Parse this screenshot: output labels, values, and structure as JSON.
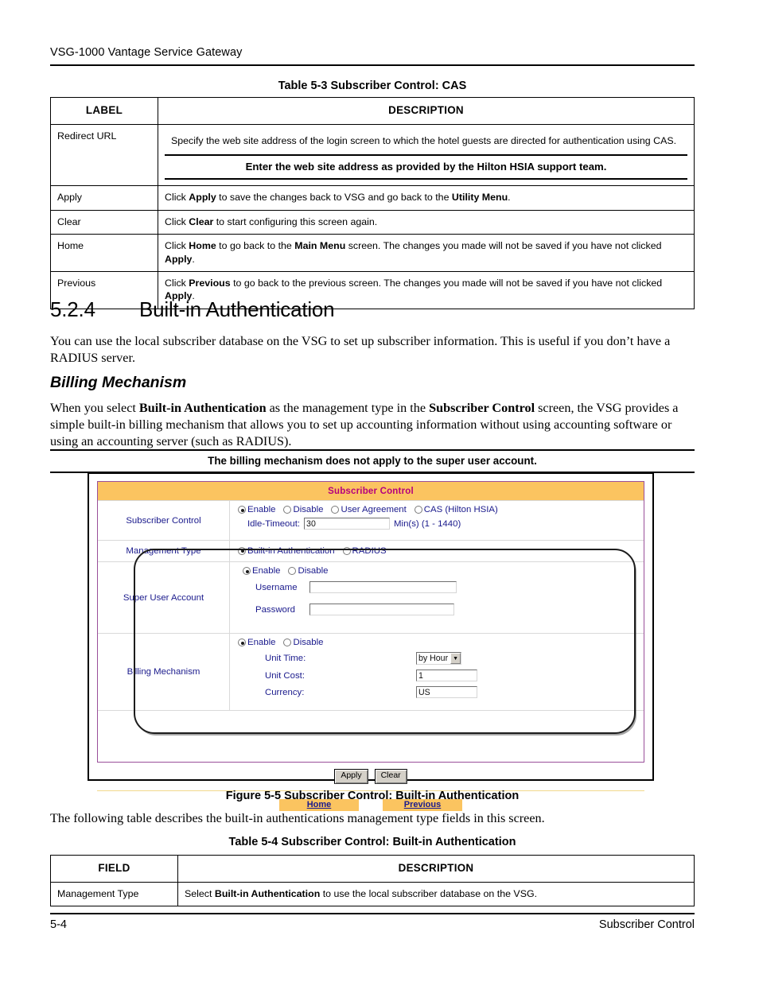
{
  "header": {
    "running_head": "VSG-1000 Vantage Service Gateway"
  },
  "table_cas": {
    "caption": "Table 5-3 Subscriber Control: CAS",
    "columns": [
      "LABEL",
      "DESCRIPTION"
    ],
    "rows": [
      {
        "label": "Redirect URL",
        "description": "Specify the web site address of the login screen to which the hotel guests are directed for authentication using CAS.",
        "note": "Enter the web site address as provided by the Hilton HSIA support team."
      },
      {
        "label": "Apply",
        "desc_pre": "Click ",
        "desc_b1": "Apply",
        "desc_mid": " to save the changes back to VSG and go back to the ",
        "desc_b2": "Utility Menu",
        "desc_post": "."
      },
      {
        "label": "Clear",
        "desc_pre": "Click ",
        "desc_b1": "Clear",
        "desc_mid": " to start configuring this screen again.",
        "desc_b2": "",
        "desc_post": ""
      },
      {
        "label": "Home",
        "desc_pre": "Click ",
        "desc_b1": "Home",
        "desc_mid": " to go back to the ",
        "desc_b2": "Main Menu",
        "desc_post": " screen. The changes you made will not be saved if you have not clicked ",
        "desc_b3": "Apply",
        "desc_tail": "."
      },
      {
        "label": "Previous",
        "desc_pre": "Click ",
        "desc_b1": "Previous",
        "desc_mid": " to go back to the previous screen. The changes you made will not be saved if you have not clicked ",
        "desc_b3": "Apply",
        "desc_tail": "."
      }
    ]
  },
  "section": {
    "number": "5.2.4",
    "title": "Built-in Authentication",
    "intro": "You can use the local subscriber database on the VSG to set up subscriber information. This is useful if you don’t have a RADIUS server.",
    "subheading": "Billing Mechanism",
    "para_pre": "When you select ",
    "para_b1": "Built-in Authentication",
    "para_mid": " as the management type in the ",
    "para_b2": "Subscriber Control",
    "para_post": " screen, the VSG provides a simple built-in billing mechanism that allows you to set up accounting information without using accounting software or using an accounting server (such as RADIUS).",
    "note": "The billing mechanism does not apply to the super user account."
  },
  "figure": {
    "caption": "Figure 5-5 Subscriber Control: Built-in Authentication",
    "screen": {
      "title": "Subscriber Control",
      "colors": {
        "title_bar": "#fbc460",
        "title_text": "#b5007e",
        "panel_border": "#9a4f9a",
        "label_text": "#1a1a8c",
        "nav_button": "#fbc460"
      },
      "rows": [
        {
          "label": "Subscriber Control",
          "options": [
            {
              "text": "Enable",
              "selected": true
            },
            {
              "text": "Disable",
              "selected": false
            },
            {
              "text": "User Agreement",
              "selected": false
            },
            {
              "text": "CAS (Hilton HSIA)",
              "selected": false
            }
          ],
          "idle_label": "Idle-Timeout:",
          "idle_value": "30",
          "idle_units": "Min(s) (1 - 1440)"
        },
        {
          "label": "Management Type",
          "options": [
            {
              "text": "Built-in Authentication",
              "selected": true
            },
            {
              "text": "RADIUS",
              "selected": false
            }
          ]
        },
        {
          "label": "Super User Account",
          "options": [
            {
              "text": "Enable",
              "selected": true
            },
            {
              "text": "Disable",
              "selected": false
            }
          ],
          "fields": [
            {
              "label": "Username",
              "value": ""
            },
            {
              "label": "Password",
              "value": ""
            }
          ]
        },
        {
          "label": "Billing Mechanism",
          "options": [
            {
              "text": "Enable",
              "selected": true
            },
            {
              "text": "Disable",
              "selected": false
            }
          ],
          "fields": [
            {
              "label": "Unit Time:",
              "value": "by Hour",
              "type": "select"
            },
            {
              "label": "Unit Cost:",
              "value": "1",
              "type": "text"
            },
            {
              "label": "Currency:",
              "value": "US",
              "type": "text"
            }
          ]
        }
      ],
      "buttons": {
        "apply": "Apply",
        "clear": "Clear",
        "home": "Home",
        "previous": "Previous"
      }
    }
  },
  "after_figure": {
    "text": "The following table describes the built-in authentications management type fields in this screen."
  },
  "table_builtin": {
    "caption": "Table 5-4 Subscriber Control: Built-in Authentication",
    "columns": [
      "FIELD",
      "DESCRIPTION"
    ],
    "rows": [
      {
        "field": "Management Type",
        "desc_pre": "Select ",
        "desc_b1": "Built-in Authentication",
        "desc_post": " to use the local subscriber database on the VSG."
      }
    ]
  },
  "footer": {
    "page_number": "5-4",
    "chapter": "Subscriber Control"
  }
}
